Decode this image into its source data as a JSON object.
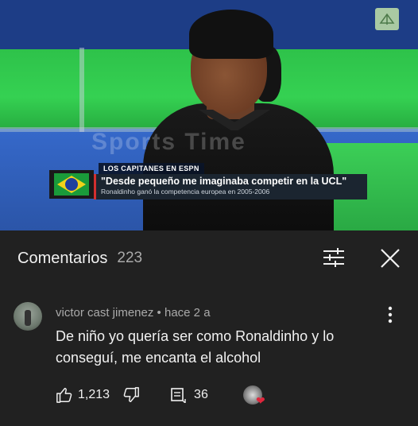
{
  "video": {
    "watermark": "Sports Time",
    "lower_third": {
      "program": "LOS CAPITANES EN ESPN",
      "quote": "\"Desde pequeño me imaginaba competir en la UCL\"",
      "caption": "Ronaldinho ganó la competencia europea en 2005-2006"
    }
  },
  "comments_header": {
    "title": "Comentarios",
    "count": "223"
  },
  "comment": {
    "author": "victor cast jimenez",
    "separator": "•",
    "time": "hace 2 a",
    "text": "De niño yo quería ser como Ronaldinho y lo conseguí, me encanta el alcohol",
    "likes": "1,213",
    "replies": "36"
  },
  "colors": {
    "background": "#212121",
    "text_primary": "#f1f1f1",
    "text_secondary": "#aaaaaa",
    "heart": "#e0263c"
  }
}
